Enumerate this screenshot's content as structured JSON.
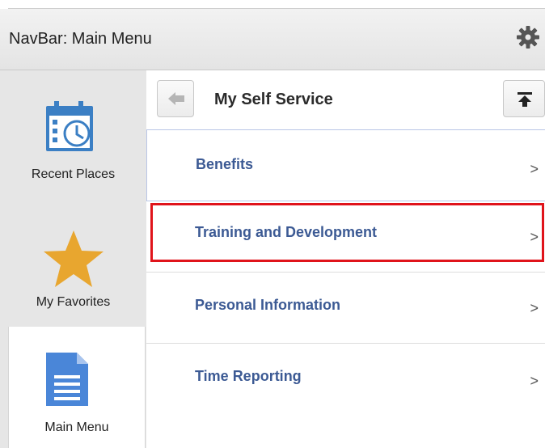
{
  "header": {
    "title": "NavBar: Main Menu",
    "settings_icon": "gear-icon"
  },
  "sidebar": {
    "items": [
      {
        "label": "Recent Places",
        "icon": "calendar-clock-icon",
        "icon_color": "#3b7fc4"
      },
      {
        "label": "My Favorites",
        "icon": "star-icon",
        "icon_color": "#e8a62f"
      },
      {
        "label": "Main Menu",
        "icon": "document-icon",
        "icon_color": "#4a86d8",
        "selected": true
      }
    ]
  },
  "panel": {
    "title": "My Self Service",
    "back_icon": "arrow-left-icon",
    "top_icon": "arrow-to-top-icon",
    "items": [
      {
        "label": "Benefits"
      },
      {
        "label": "Training and Development",
        "highlighted": true
      },
      {
        "label": "Personal Information"
      },
      {
        "label": "Time Reporting"
      }
    ],
    "chevron": ">"
  },
  "colors": {
    "link": "#3c5a94",
    "highlight_border": "#e0141b"
  }
}
